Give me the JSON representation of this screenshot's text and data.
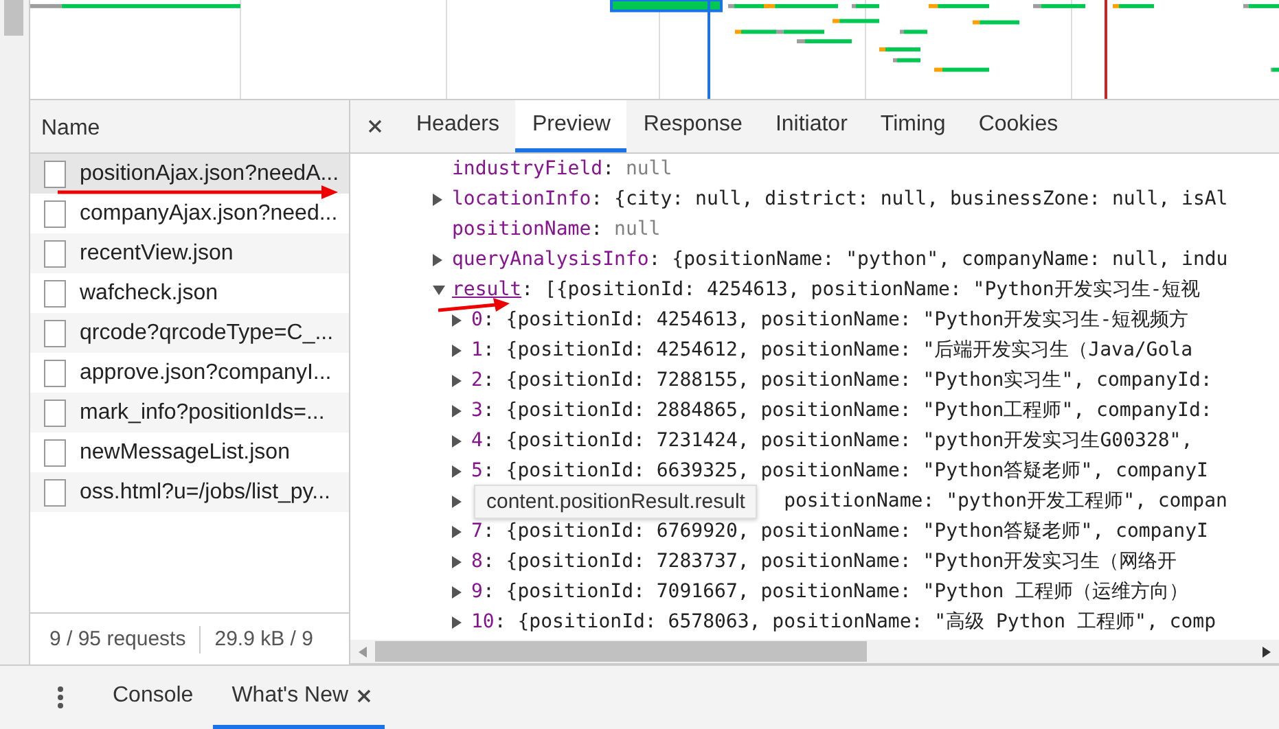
{
  "requests": {
    "header": "Name",
    "items": [
      {
        "name": "positionAjax.json?needA...",
        "selected": true
      },
      {
        "name": "companyAjax.json?need...",
        "selected": false
      },
      {
        "name": "recentView.json",
        "selected": false
      },
      {
        "name": "wafcheck.json",
        "selected": false
      },
      {
        "name": "qrcode?qrcodeType=C_...",
        "selected": false
      },
      {
        "name": "approve.json?companyI...",
        "selected": false
      },
      {
        "name": "mark_info?positionIds=...",
        "selected": false
      },
      {
        "name": "newMessageList.json",
        "selected": false
      },
      {
        "name": "oss.html?u=/jobs/list_py...",
        "selected": false
      }
    ],
    "status": [
      "9 / 95 requests",
      "29.9 kB / 9"
    ]
  },
  "tabs": [
    {
      "label": "Headers",
      "selected": false
    },
    {
      "label": "Preview",
      "selected": true
    },
    {
      "label": "Response",
      "selected": false
    },
    {
      "label": "Initiator",
      "selected": false
    },
    {
      "label": "Timing",
      "selected": false
    },
    {
      "label": "Cookies",
      "selected": false
    }
  ],
  "preview": {
    "lines": [
      {
        "kind": "leaf",
        "key": "industryField",
        "sep": ":",
        "value": "null"
      },
      {
        "kind": "collapsed",
        "key": "locationInfo",
        "sep": ":",
        "value": "{city: null, district: null, businessZone: null, isAl"
      },
      {
        "kind": "leaf",
        "key": "positionName",
        "sep": ":",
        "value": "null"
      },
      {
        "kind": "collapsed",
        "key": "queryAnalysisInfo",
        "sep": ":",
        "value": "{positionName: \"python\", companyName: null, indu"
      },
      {
        "kind": "expanded",
        "key": "result",
        "sep": ":",
        "value": "[{positionId: 4254613, positionName: \"Python开发实习生-短视",
        "children": [
          {
            "index": "0",
            "sep": ":",
            "value": "{positionId: 4254613, positionName: \"Python开发实习生-短视频方"
          },
          {
            "index": "1",
            "sep": ":",
            "value": "{positionId: 4254612, positionName: \"后端开发实习生（Java/Gola"
          },
          {
            "index": "2",
            "sep": ":",
            "value": "{positionId: 7288155, positionName: \"Python实习生\", companyId:"
          },
          {
            "index": "3",
            "sep": ":",
            "value": "{positionId: 2884865, positionName: \"Python工程师\", companyId:"
          },
          {
            "index": "4",
            "sep": ":",
            "value": "{positionId: 7231424, positionName: \"python开发实习生G00328\","
          },
          {
            "index": "5",
            "sep": ":",
            "value": "{positionId: 6639325, positionName: \"Python答疑老师\", companyI"
          },
          {
            "value": "positionName: \"python开发工程师\", compan"
          },
          {
            "index": "7",
            "sep": ":",
            "value": "{positionId: 6769920, positionName: \"Python答疑老师\", companyI"
          },
          {
            "index": "8",
            "sep": ":",
            "value": "{positionId: 7283737, positionName: \"Python开发实习生（网络开"
          },
          {
            "index": "9",
            "sep": ":",
            "value": "{positionId: 7091667, positionName: \"Python 工程师（运维方向）"
          },
          {
            "index": "10",
            "sep": ":",
            "value": "{positionId: 6578063, positionName: \"高级 Python 工程师\", comp"
          }
        ]
      }
    ],
    "tooltip": "content.positionResult.result"
  },
  "drawer_tabs": [
    {
      "label": "Console",
      "selected": false,
      "closable": false
    },
    {
      "label": "What's New",
      "selected": true,
      "closable": true
    }
  ]
}
